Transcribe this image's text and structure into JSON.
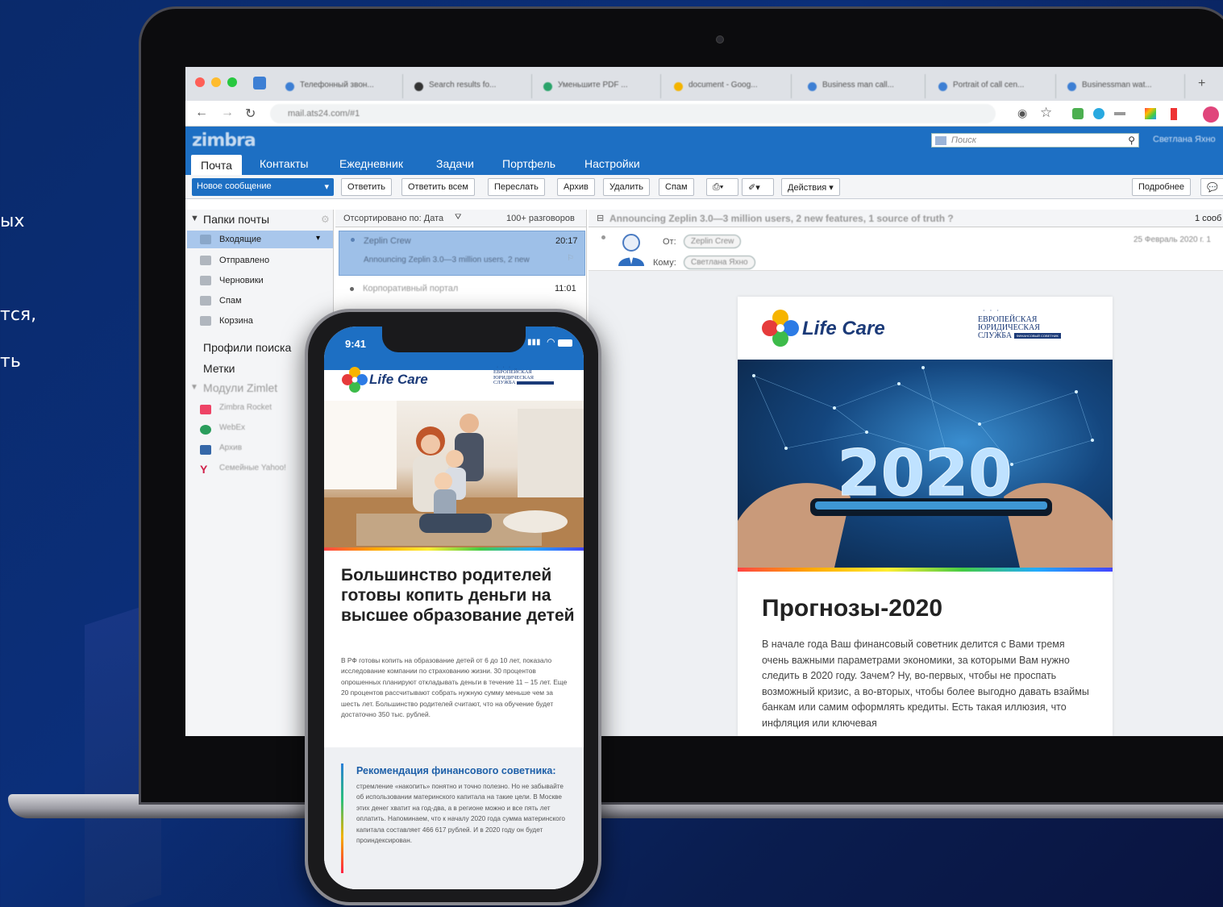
{
  "left_text": [
    "ых",
    "тся,",
    "ть"
  ],
  "browser": {
    "tabs": [
      "Телефонный звон...",
      "Search results fo...",
      "Уменьшите PDF ...",
      "document - Goog...",
      "Business man call...",
      "Portrait of call cen...",
      "Businessman wat..."
    ],
    "url": "mail.ats24.com/#1"
  },
  "zimbra": {
    "logo": "zimbra",
    "search_placeholder": "Поиск",
    "user": "Светлана Яхно",
    "tabs": [
      "Почта",
      "Контакты",
      "Ежедневник",
      "Задачи",
      "Портфель",
      "Настройки"
    ],
    "new_message": "Новое сообщение",
    "toolbar": [
      "Ответить",
      "Ответить всем",
      "Переслать",
      "Архив",
      "Удалить",
      "Спам",
      "Действия",
      "Подробнее"
    ],
    "sidebar": {
      "folders_title": "Папки почты",
      "folders": [
        "Входящие",
        "Отправлено",
        "Черновики",
        "Спам",
        "Корзина"
      ],
      "search_profiles": "Профили поиска",
      "tags": "Метки",
      "zimlets_title": "Модули Zimlet",
      "zimlets": [
        "Zimbra Rocket",
        "WebEx",
        "Архив",
        "Семейные Yahoo!"
      ]
    },
    "list": {
      "sort_label": "Отсортировано по: Дата",
      "count": "100+ разговоров",
      "rows": [
        {
          "from": "Zeplin Crew",
          "subject": "Announcing Zeplin 3.0—3 million users, 2 new",
          "time": "20:17"
        },
        {
          "from": "Корпоративный портал",
          "subject": "",
          "time": "11:01"
        }
      ]
    },
    "reading": {
      "subject": "Announcing Zeplin 3.0—3 million users, 2 new features, 1 source of truth ?",
      "count": "1 сооб",
      "from_label": "От:",
      "from": "Zeplin Crew",
      "to_label": "Кому:",
      "to": "Светлана Яхно",
      "date": "25 Февраль 2020 г. 1"
    }
  },
  "email": {
    "brand": "Life Care",
    "eu_lines": [
      "ЕВРОПЕЙСКАЯ",
      "ЮРИДИЧЕСКАЯ",
      "СЛУЖБА"
    ],
    "eu_tag": "ФИНАНСОВЫЙ СОВЕТНИК",
    "hero_year": "2020",
    "title": "Прогнозы-2020",
    "text": "В начале года Ваш финансовый советник делится с Вами тремя очень важными параметрами экономики, за которыми Вам нужно следить в 2020 году. Зачем? Ну, во-первых, чтобы не проспать возможный кризис, а во-вторых, чтобы более выгодно давать взаймы банкам или самим оформлять кредиты. Есть такая иллюзия, что инфляция или ключевая"
  },
  "phone": {
    "time": "9:41",
    "brand": "Life Care",
    "title": "Большинство родителей готовы копить деньги на высшее образование детей",
    "body": "В РФ готовы копить на образование детей от 6 до 10 лет, показало исследование компании по страхованию жизни. 30 процентов опрошенных планируют откладывать деньги в течение 11 – 15 лет. Еще 20 процентов рассчитывают собрать нужную сумму меньше чем за шесть лет. Большинство родителей считают, что на обучение будет достаточно 350 тыс. рублей.",
    "advice_title": "Рекомендация финансового советника:",
    "advice_text": "стремление «накопить» понятно и точно полезно. Но не забывайте об использовании материнского капитала на такие цели. В Москве этих денег хватит на год-два, а в регионе можно и все пять лет оплатить. Напоминаем, что к началу 2020 года сумма материнского капитала составляет 466 617 рублей. И в 2020 году он будет проиндексирован."
  }
}
